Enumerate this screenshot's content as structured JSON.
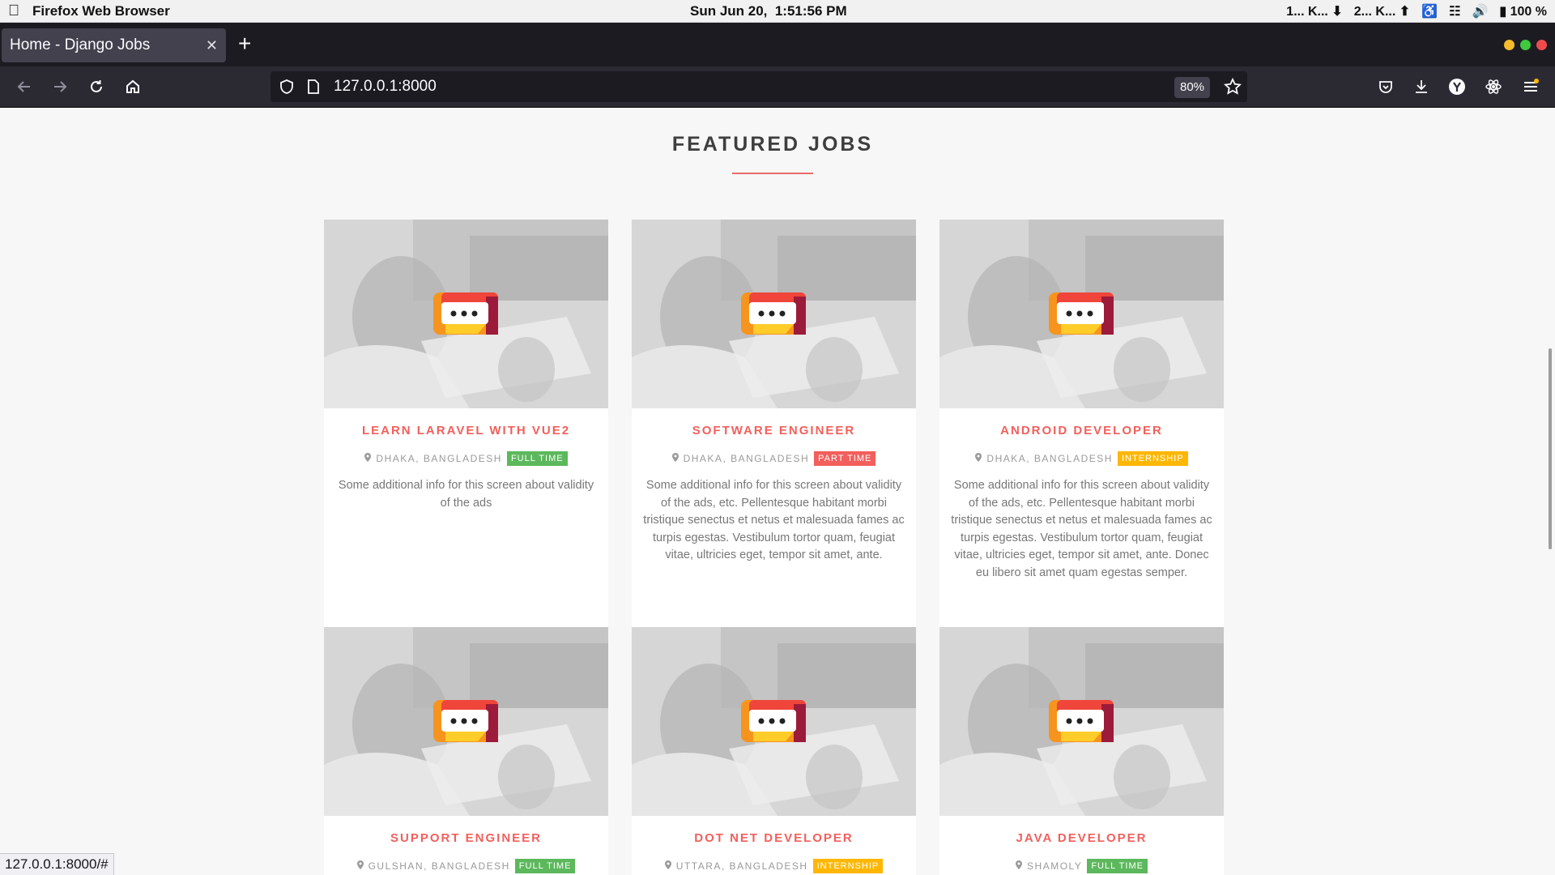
{
  "os": {
    "app_name": "Firefox Web Browser",
    "clock": "Sun Jun 20,  1:51:56 PM",
    "net_down": "1... K...",
    "net_up": "2... K...",
    "battery": "100 %"
  },
  "browser": {
    "tab_title": "Home - Django Jobs",
    "url": "127.0.0.1:8000",
    "zoom": "80%",
    "status_url": "127.0.0.1:8000/#"
  },
  "page": {
    "section_title": "FEATURED JOBS",
    "jobs": [
      {
        "title": "LEARN LARAVEL WITH VUE2",
        "location": "DHAKA, BANGLADESH",
        "type": "FULL TIME",
        "type_kind": "full",
        "description": "Some additional info for this screen about validity of the ads"
      },
      {
        "title": "SOFTWARE ENGINEER",
        "location": "DHAKA, BANGLADESH",
        "type": "PART TIME",
        "type_kind": "part",
        "description": "Some additional info for this screen about validity of the ads, etc. Pellentesque habitant morbi tristique senectus et netus et malesuada fames ac turpis egestas. Vestibulum tortor quam, feugiat vitae, ultricies eget, tempor sit amet, ante."
      },
      {
        "title": "ANDROID DEVELOPER",
        "location": "DHAKA, BANGLADESH",
        "type": "INTERNSHIP",
        "type_kind": "intern",
        "description": "Some additional info for this screen about validity of the ads, etc. Pellentesque habitant morbi tristique senectus et netus et malesuada fames ac turpis egestas. Vestibulum tortor quam, feugiat vitae, ultricies eget, tempor sit amet, ante. Donec eu libero sit amet quam egestas semper."
      },
      {
        "title": "SUPPORT ENGINEER",
        "location": "GULSHAN, BANGLADESH",
        "type": "FULL TIME",
        "type_kind": "full",
        "description": ""
      },
      {
        "title": "DOT NET DEVELOPER",
        "location": "UTTARA, BANGLADESH",
        "type": "INTERNSHIP",
        "type_kind": "intern",
        "description": ""
      },
      {
        "title": "JAVA DEVELOPER",
        "location": "SHAMOLY",
        "type": "FULL TIME",
        "type_kind": "full",
        "description": ""
      }
    ]
  },
  "colors": {
    "accent": "#f25f5c",
    "full_time": "#5cb85c",
    "part_time": "#f25f5c",
    "internship": "#ffb703"
  },
  "icons": {
    "back": "arrow-left-icon",
    "forward": "arrow-right-icon",
    "reload": "reload-icon",
    "home": "home-icon",
    "shield": "shield-icon",
    "page": "page-icon",
    "star": "star-icon",
    "pocket": "pocket-icon",
    "download": "download-icon",
    "profile": "profile-icon",
    "extension": "extension-icon",
    "menu": "menu-icon",
    "location_pin": "map-pin-icon"
  }
}
